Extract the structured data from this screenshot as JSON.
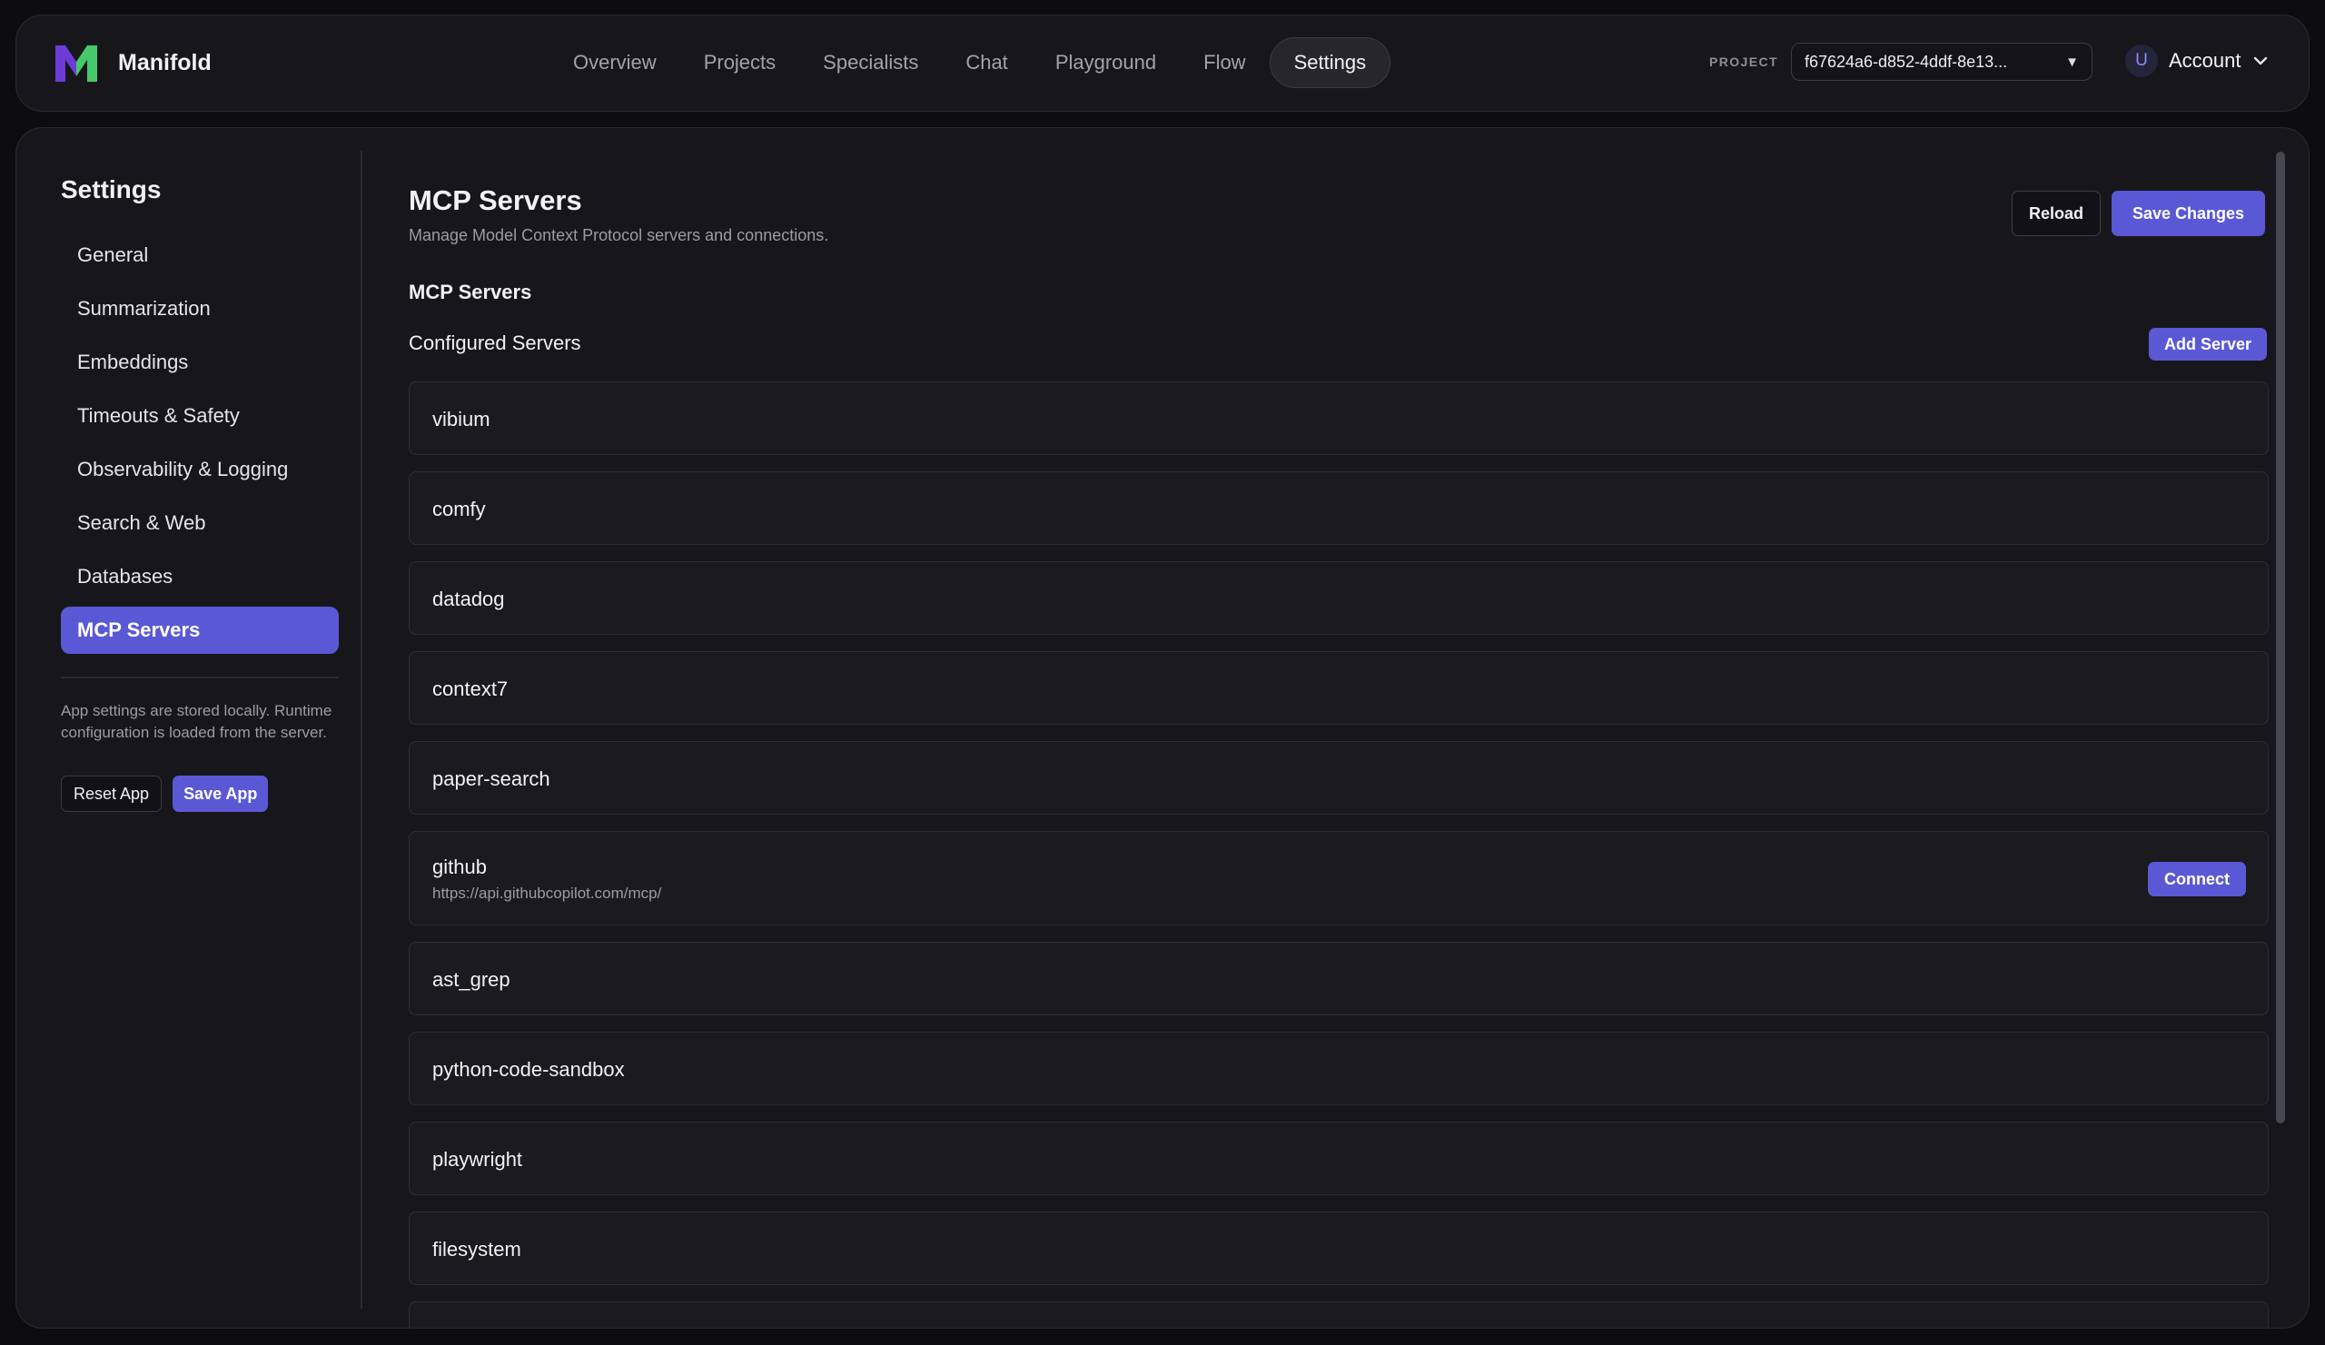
{
  "app": {
    "name": "Manifold",
    "brand_colors": {
      "m_left": "#6c3bd8",
      "m_right": "#45c96b",
      "accent": "#5b58d6"
    }
  },
  "nav": {
    "items": [
      "Overview",
      "Projects",
      "Specialists",
      "Chat",
      "Playground",
      "Flow",
      "Settings"
    ],
    "active": "Settings"
  },
  "project": {
    "label": "PROJECT",
    "value": "f67624a6-d852-4ddf-8e13...",
    "caret": "▼"
  },
  "account": {
    "avatar_initial": "U",
    "label": "Account"
  },
  "sidebar": {
    "title": "Settings",
    "items": [
      {
        "label": "General"
      },
      {
        "label": "Summarization"
      },
      {
        "label": "Embeddings"
      },
      {
        "label": "Timeouts & Safety"
      },
      {
        "label": "Observability & Logging"
      },
      {
        "label": "Search & Web"
      },
      {
        "label": "Databases"
      },
      {
        "label": "MCP Servers"
      }
    ],
    "active": "MCP Servers",
    "note": "App settings are stored locally. Runtime configuration is loaded from the server.",
    "reset_label": "Reset App",
    "save_label": "Save App"
  },
  "main": {
    "title": "MCP Servers",
    "description": "Manage Model Context Protocol servers and connections.",
    "reload_label": "Reload",
    "save_label": "Save Changes",
    "section_title": "MCP Servers",
    "configured_title": "Configured Servers",
    "add_server_label": "Add Server",
    "servers": [
      {
        "name": "vibium"
      },
      {
        "name": "comfy"
      },
      {
        "name": "datadog"
      },
      {
        "name": "context7"
      },
      {
        "name": "paper-search"
      },
      {
        "name": "github",
        "url": "https://api.githubcopilot.com/mcp/",
        "action": "Connect"
      },
      {
        "name": "ast_grep"
      },
      {
        "name": "python-code-sandbox"
      },
      {
        "name": "playwright"
      },
      {
        "name": "filesystem"
      }
    ]
  }
}
